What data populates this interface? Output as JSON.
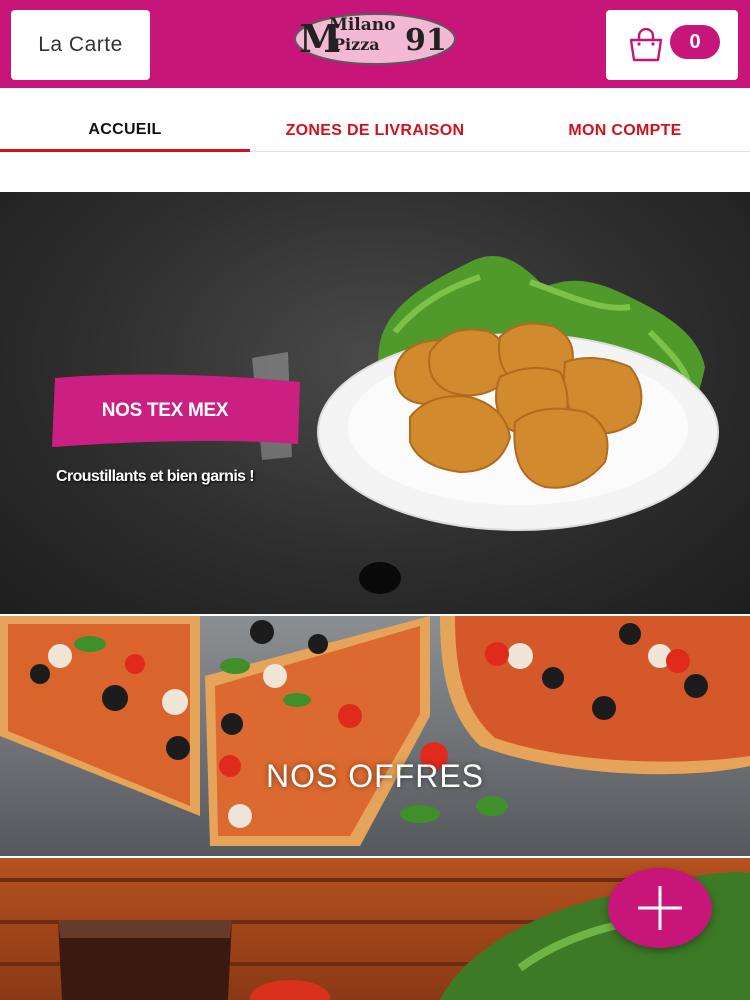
{
  "header": {
    "menu_label": "La Carte",
    "logo_text_top": "Milano",
    "logo_text_bottom": "Pizza",
    "logo_number": "91",
    "cart_count": "0",
    "brand_color": "#c8157a"
  },
  "nav": {
    "tabs": [
      {
        "label": "ACCUEIL",
        "active": true
      },
      {
        "label": "ZONES DE LIVRAISON",
        "active": false
      },
      {
        "label": "MON COMPTE",
        "active": false
      }
    ],
    "active_color": "#d3111c"
  },
  "hero": {
    "ribbon_label": "NOS TEX MEX",
    "tagline": "Croustillants et bien garnis !"
  },
  "offers": {
    "title": "NOS OFFRES"
  },
  "icons": {
    "cart": "shopping-bag-icon",
    "fab": "plus-icon"
  }
}
